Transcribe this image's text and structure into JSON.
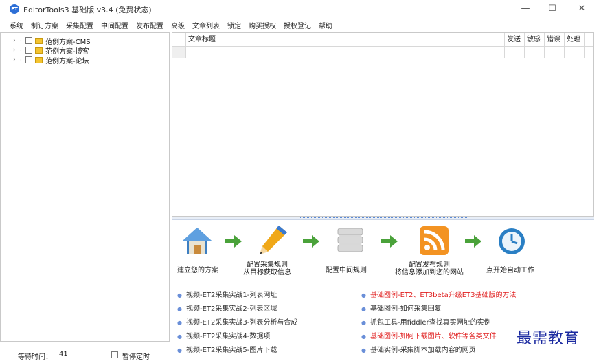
{
  "window": {
    "icon_text": "ET",
    "title": "EditorTools3 基础版 v3.4 (免费状态)",
    "minimize": "—",
    "maximize": "☐",
    "close": "✕"
  },
  "menu": [
    "系统",
    "制订方案",
    "采集配置",
    "中间配置",
    "发布配置",
    "高级",
    "文章列表",
    "锁定",
    "购买授权",
    "授权登记",
    "帮助"
  ],
  "tree": {
    "items": [
      {
        "label": "范例方案-CMS"
      },
      {
        "label": "范例方案-博客"
      },
      {
        "label": "范例方案-论坛"
      }
    ]
  },
  "status": {
    "wait_label": "等待时间：",
    "wait_value": "41",
    "pause_label": "暂停定时"
  },
  "table": {
    "headers": [
      "",
      "文章标题",
      "发送",
      "敏感",
      "错误",
      "处理"
    ]
  },
  "flow": {
    "steps": [
      {
        "label1": "建立您的方案",
        "label2": ""
      },
      {
        "label1": "配置采集规则",
        "label2": "从目标获取信息"
      },
      {
        "label1": "配置中间规则",
        "label2": ""
      },
      {
        "label1": "配置发布规则",
        "label2": "将信息添加到您的网站"
      },
      {
        "label1": "点开始自动工作",
        "label2": ""
      }
    ]
  },
  "links": {
    "left": [
      "视频-ET2采集实战1-列表网址",
      "视频-ET2采集实战2-列表区域",
      "视频-ET2采集实战3-列表分析与合成",
      "视频-ET2采集实战4-数据项",
      "视频-ET2采集实战5-图片下载"
    ],
    "right": [
      {
        "text": "基础图例-ET2、ET3beta升级ET3基础版的方法",
        "red": true
      },
      {
        "text": "基础图例-如何采集回复",
        "red": false
      },
      {
        "text": "抓包工具-用fiddler查找真实网址的实例",
        "red": false
      },
      {
        "text": "基础图例-如何下载图片、软件等各类文件",
        "red": true
      },
      {
        "text": "基础实例-采集脚本加载内容的网页",
        "red": false
      }
    ]
  },
  "watermark": "最需教育",
  "colors": {
    "link_red": "#e02020",
    "link_dark": "#333333",
    "accent": "#2d6fd6"
  }
}
